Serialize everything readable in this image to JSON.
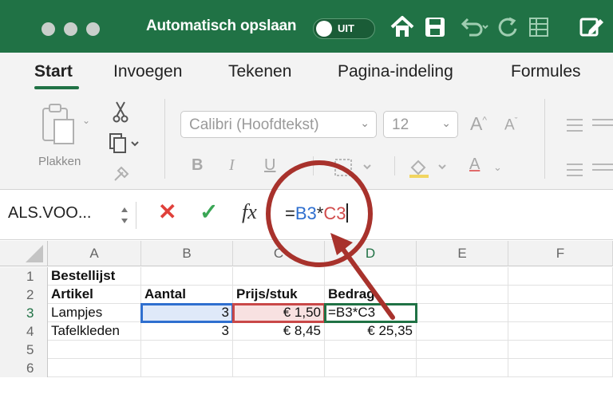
{
  "titlebar": {
    "autosave_label": "Automatisch opslaan",
    "autosave_state": "UIT",
    "icons": [
      "home-icon",
      "save-icon",
      "undo-icon",
      "redo-icon",
      "spreadsheet-icon",
      "edit-icon"
    ]
  },
  "tabs": [
    "Start",
    "Invoegen",
    "Tekenen",
    "Pagina-indeling",
    "Formules"
  ],
  "active_tab": "Start",
  "ribbon": {
    "paste_label": "Plakken",
    "font_name": "Calibri (Hoofdtekst)",
    "font_size": "12",
    "bold": "B",
    "italic": "I",
    "underline": "U",
    "grow_font": "A",
    "shrink_font": "A",
    "font_color": "A"
  },
  "formula_bar": {
    "name_box": "ALS.VOO...",
    "fx_label": "fx",
    "formula_eq": "=",
    "formula_ref1": "B3",
    "formula_op": "*",
    "formula_ref2": "C3"
  },
  "sheet": {
    "columns": [
      "A",
      "B",
      "C",
      "D",
      "E",
      "F"
    ],
    "rows": [
      "1",
      "2",
      "3",
      "4",
      "5",
      "6"
    ],
    "cells": {
      "A1": "Bestellijst",
      "A2": "Artikel",
      "B2": "Aantal",
      "C2": "Prijs/stuk",
      "D2": "Bedrag",
      "A3": "Lampjes",
      "B3": "3",
      "C3": "€ 1,50",
      "D3": "=B3*C3",
      "A4": "Tafelkleden",
      "B4": "3",
      "C4": "€ 8,45",
      "D4": "€ 25,35"
    }
  },
  "colors": {
    "excel_green": "#207245",
    "ref_blue": "#2f6fcf",
    "ref_red": "#c94848",
    "annotation_red": "#a8322c"
  }
}
